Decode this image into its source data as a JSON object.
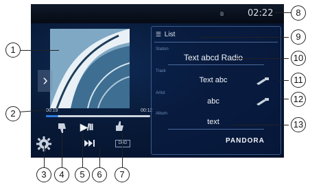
{
  "status_bar": {
    "clock": "02:22",
    "bluetooth_icon": "bluetooth-icon"
  },
  "player": {
    "time_elapsed": "00:19",
    "time_total": "00:12",
    "progress": 0.12,
    "play_pause_label": "▶/II",
    "hd_badge": "DHD"
  },
  "panel": {
    "list_label": "List",
    "station_label": "Station",
    "station_value": "Text abcd Radio",
    "track_label": "Track",
    "track_value": "Text abc",
    "artist_label": "Artist",
    "artist_value": "abc",
    "album_label": "Album",
    "album_value": "text",
    "brand": "PANDORA"
  },
  "callouts": {
    "c1": "1",
    "c2": "2",
    "c3": "3",
    "c4": "4",
    "c5": "5",
    "c6": "6",
    "c7": "7",
    "c8": "8",
    "c9": "9",
    "c10": "10",
    "c11": "11",
    "c12": "12",
    "c13": "13"
  },
  "colors": {
    "screen_bg": "#081a38",
    "accent": "#2a7be0",
    "panel_border": "#3a5c8e"
  }
}
